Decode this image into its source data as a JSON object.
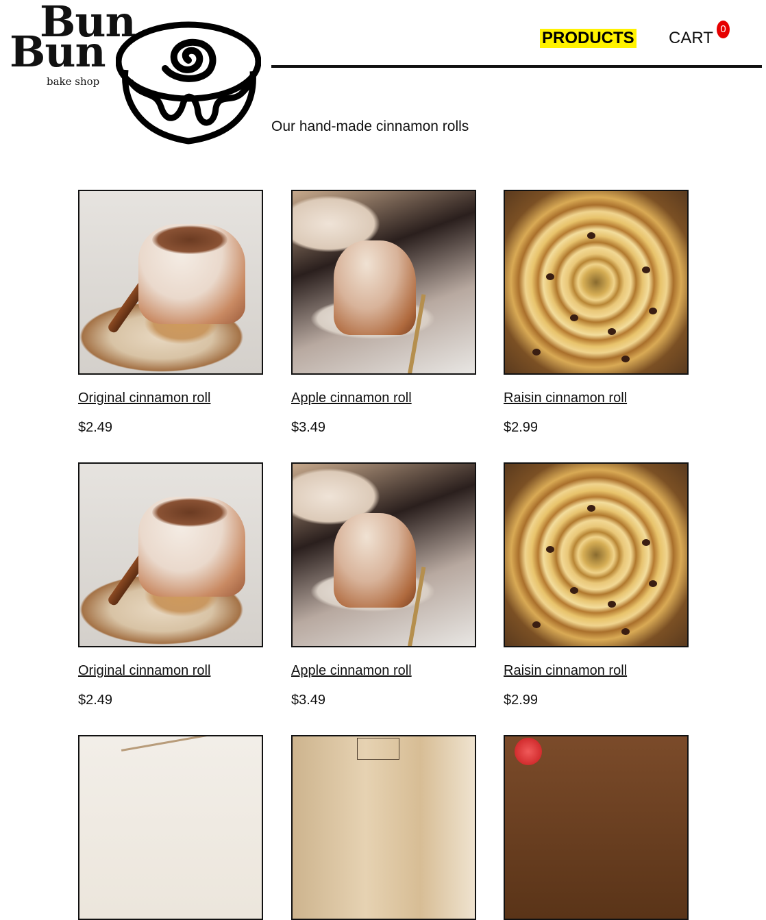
{
  "brand": {
    "line1": "Bun",
    "line2": "Bun",
    "subtitle": "bake shop"
  },
  "nav": {
    "products_label": "PRODUCTS",
    "cart_label": "CART",
    "cart_count": "0",
    "highlight_color": "#fff200",
    "badge_color": "#e60000"
  },
  "tagline": "Our hand-made cinnamon rolls",
  "products": [
    {
      "name": "Original cinnamon roll",
      "price": "$2.49",
      "photo": "original"
    },
    {
      "name": "Apple cinnamon roll",
      "price": "$3.49",
      "photo": "apple"
    },
    {
      "name": "Raisin cinnamon roll",
      "price": "$2.99",
      "photo": "raisin"
    },
    {
      "name": "Original cinnamon roll",
      "price": "$2.49",
      "photo": "original"
    },
    {
      "name": "Apple cinnamon roll",
      "price": "$3.49",
      "photo": "apple"
    },
    {
      "name": "Raisin cinnamon roll",
      "price": "$2.99",
      "photo": "raisin"
    }
  ],
  "partial_row_photos": [
    "flower",
    "bag",
    "berry"
  ]
}
